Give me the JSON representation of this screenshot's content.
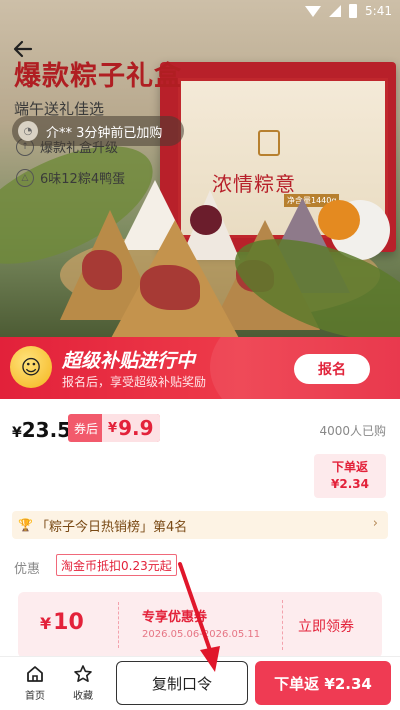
{
  "status_bar": {
    "time": "5:41"
  },
  "hero": {
    "title": "爆款粽子礼盒",
    "subtitle": "端午送礼佳选",
    "bullets": [
      "爆款礼盒升级",
      "6味12粽4鸭蛋"
    ],
    "box_title": "浓情粽意",
    "box_label": "净含量1440g"
  },
  "toast": {
    "text": "介** 3分钟前已加购"
  },
  "subsidy": {
    "title": "超级补贴进行中",
    "desc": "报名后，享受超级补贴奖励",
    "button": "报名"
  },
  "price": {
    "currency": "¥",
    "value": "23.5",
    "coupon_label": "券后",
    "coupon_currency": "¥",
    "coupon_value": "9.9",
    "sold": "4000人已购",
    "rebate_label": "下单返",
    "rebate_value": "¥2.34"
  },
  "rank": {
    "text": "「粽子今日热销榜」第4名"
  },
  "discount": {
    "label": "优惠",
    "tag": "淘金币抵扣0.23元起"
  },
  "coupon_card": {
    "currency": "¥",
    "amount": "10",
    "title": "专享优惠券",
    "date": "2026.05.06-2026.05.11",
    "claim": "立即领券"
  },
  "bottom_bar": {
    "home": "首页",
    "favorite": "收藏",
    "copy": "复制口令",
    "buy": "下单返 ¥2.34"
  },
  "colors": {
    "accent": "#ef3b53",
    "banner": "#e2213a",
    "coupon_text": "#e3223a"
  }
}
